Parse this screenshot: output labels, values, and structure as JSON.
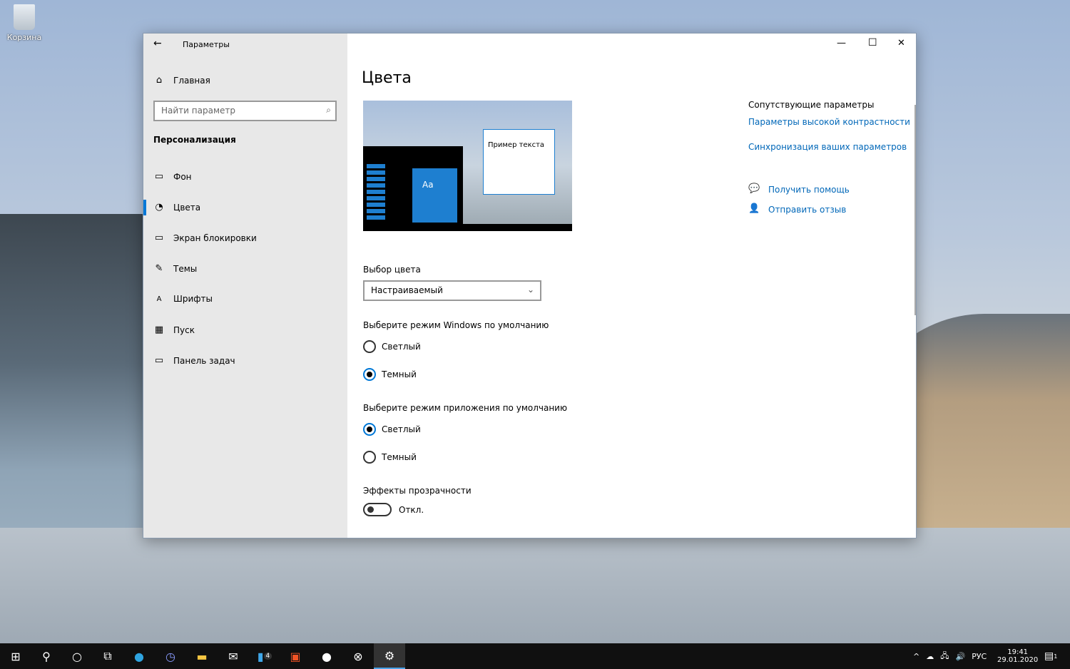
{
  "desktop": {
    "recycle_bin": "Корзина"
  },
  "window": {
    "title": "Параметры",
    "minimize": "—",
    "maximize": "☐",
    "close": "✕",
    "back": "←"
  },
  "sidebar": {
    "home": "Главная",
    "search_placeholder": "Найти параметр",
    "section": "Персонализация",
    "items": [
      {
        "label": "Фон",
        "icon": "image-icon"
      },
      {
        "label": "Цвета",
        "icon": "palette-icon",
        "selected": true
      },
      {
        "label": "Экран блокировки",
        "icon": "lock-screen-icon"
      },
      {
        "label": "Темы",
        "icon": "themes-icon"
      },
      {
        "label": "Шрифты",
        "icon": "fonts-icon"
      },
      {
        "label": "Пуск",
        "icon": "start-icon"
      },
      {
        "label": "Панель задач",
        "icon": "taskbar-icon"
      }
    ]
  },
  "main": {
    "title": "Цвета",
    "preview_text": "Пример текста",
    "preview_tile": "Aa",
    "color_choice_label": "Выбор цвета",
    "color_choice_value": "Настраиваемый",
    "windows_mode_label": "Выберите режим Windows по умолчанию",
    "windows_mode": {
      "light": "Светлый",
      "dark": "Темный",
      "selected": "dark"
    },
    "app_mode_label": "Выберите режим приложения по умолчанию",
    "app_mode": {
      "light": "Светлый",
      "dark": "Темный",
      "selected": "light"
    },
    "transparency_label": "Эффекты прозрачности",
    "transparency_value": "Откл.",
    "related_title": "Сопутствующие параметры",
    "related_links": [
      "Параметры высокой контрастности",
      "Синхронизация ваших параметров"
    ],
    "help": "Получить помощь",
    "feedback": "Отправить отзыв"
  },
  "accent": "#0078d7",
  "taskbar": {
    "apps": [
      "start",
      "search",
      "cortana",
      "task-view",
      "edge",
      "speedtest",
      "explorer",
      "mail",
      "phone",
      "store",
      "app",
      "xbox",
      "settings"
    ],
    "phone_badge": "4",
    "lang": "РУС",
    "time": "19:41",
    "date": "29.01.2020",
    "notif_count": "1"
  }
}
